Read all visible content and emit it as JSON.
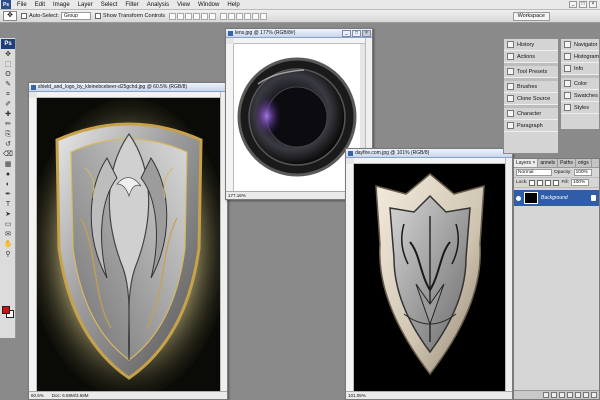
{
  "menubar": {
    "app_logo": "Ps",
    "items": [
      "File",
      "Edit",
      "Image",
      "Layer",
      "Select",
      "Filter",
      "Analysis",
      "View",
      "Window",
      "Help"
    ],
    "window_controls": [
      "_",
      "□",
      "×"
    ]
  },
  "options": {
    "auto_select_label": "Auto-Select:",
    "auto_select_value": "Group",
    "transform_label": "Show Transform Controls",
    "workspace_label": "Workspace"
  },
  "toolbox": {
    "badge": "Ps",
    "tools": [
      "move-tool",
      "marquee-tool",
      "lasso-tool",
      "quick-select-tool",
      "crop-tool",
      "eyedropper-tool",
      "healing-tool",
      "brush-tool",
      "clone-stamp-tool",
      "history-brush-tool",
      "eraser-tool",
      "gradient-tool",
      "blur-tool",
      "dodge-tool",
      "pen-tool",
      "type-tool",
      "path-select-tool",
      "shape-tool",
      "notes-tool",
      "hand-tool",
      "zoom-tool"
    ],
    "glyphs": [
      "✥",
      "⬚",
      "ʘ",
      "✎",
      "⌗",
      "✐",
      "✚",
      "✏",
      "⎘",
      "↺",
      "⌫",
      "▦",
      "●",
      "◐",
      "✒",
      "T",
      "➤",
      "▭",
      "✉",
      "✋",
      "⚲"
    ],
    "foreground_color": "#d01010",
    "background_color": "#ffffff"
  },
  "windows": {
    "shield": {
      "title": "shield_and_logo_by_kleinebcebeer-d25gchd.jpg @ 60.5% (RGB/8)",
      "zoom": "60.5%",
      "doc": "Doc: 6.59M/3.68M"
    },
    "lens": {
      "title": "lens.jpg @ 177% (RGB/8#)",
      "zoom": "177.16%"
    },
    "dayfire": {
      "title": "dayfire.com.jpg @ 101% (RGB/8)",
      "zoom": "101.05%"
    }
  },
  "panels": {
    "left_col": [
      {
        "icon": "history-icon",
        "label": "History"
      },
      {
        "icon": "actions-icon",
        "label": "Actions"
      },
      {
        "icon": "tool-presets-icon",
        "label": "Tool Presets"
      },
      {
        "icon": "brushes-icon",
        "label": "Brushes"
      },
      {
        "icon": "clone-source-icon",
        "label": "Clone Source"
      },
      {
        "icon": "character-icon",
        "label": "Character"
      },
      {
        "icon": "paragraph-icon",
        "label": "Paragraph"
      }
    ],
    "right_col": [
      {
        "icon": "navigator-icon",
        "label": "Navigator"
      },
      {
        "icon": "histogram-icon",
        "label": "Histogram"
      },
      {
        "icon": "info-icon",
        "label": "Info"
      },
      {
        "icon": "color-icon",
        "label": "Color"
      },
      {
        "icon": "swatches-icon",
        "label": "Swatches"
      },
      {
        "icon": "styles-icon",
        "label": "Styles"
      }
    ]
  },
  "layers": {
    "tabs": [
      "Layers ×",
      "annels",
      "Paths",
      "origs"
    ],
    "blend_mode": "Normal",
    "opacity_label": "Opacity:",
    "opacity_value": "100%",
    "lock_label": "Lock:",
    "fill_label": "Fill:",
    "fill_value": "100%",
    "layer_name": "Background"
  }
}
